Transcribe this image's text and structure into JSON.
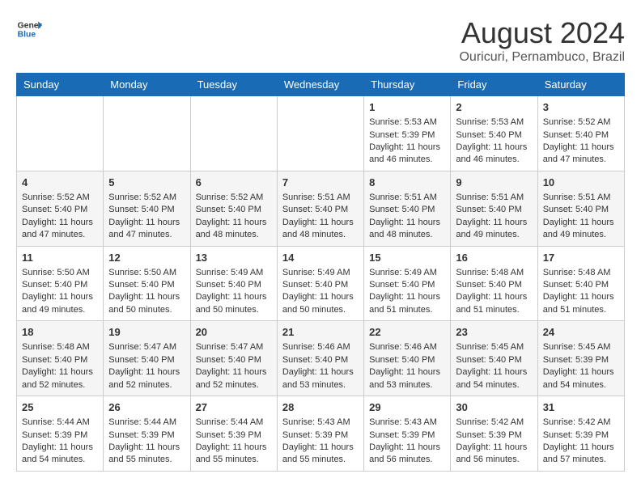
{
  "header": {
    "logo_line1": "General",
    "logo_line2": "Blue",
    "month_title": "August 2024",
    "location": "Ouricuri, Pernambuco, Brazil"
  },
  "days_of_week": [
    "Sunday",
    "Monday",
    "Tuesday",
    "Wednesday",
    "Thursday",
    "Friday",
    "Saturday"
  ],
  "weeks": [
    [
      {
        "day": "",
        "content": ""
      },
      {
        "day": "",
        "content": ""
      },
      {
        "day": "",
        "content": ""
      },
      {
        "day": "",
        "content": ""
      },
      {
        "day": "1",
        "content": "Sunrise: 5:53 AM\nSunset: 5:39 PM\nDaylight: 11 hours\nand 46 minutes."
      },
      {
        "day": "2",
        "content": "Sunrise: 5:53 AM\nSunset: 5:40 PM\nDaylight: 11 hours\nand 46 minutes."
      },
      {
        "day": "3",
        "content": "Sunrise: 5:52 AM\nSunset: 5:40 PM\nDaylight: 11 hours\nand 47 minutes."
      }
    ],
    [
      {
        "day": "4",
        "content": "Sunrise: 5:52 AM\nSunset: 5:40 PM\nDaylight: 11 hours\nand 47 minutes."
      },
      {
        "day": "5",
        "content": "Sunrise: 5:52 AM\nSunset: 5:40 PM\nDaylight: 11 hours\nand 47 minutes."
      },
      {
        "day": "6",
        "content": "Sunrise: 5:52 AM\nSunset: 5:40 PM\nDaylight: 11 hours\nand 48 minutes."
      },
      {
        "day": "7",
        "content": "Sunrise: 5:51 AM\nSunset: 5:40 PM\nDaylight: 11 hours\nand 48 minutes."
      },
      {
        "day": "8",
        "content": "Sunrise: 5:51 AM\nSunset: 5:40 PM\nDaylight: 11 hours\nand 48 minutes."
      },
      {
        "day": "9",
        "content": "Sunrise: 5:51 AM\nSunset: 5:40 PM\nDaylight: 11 hours\nand 49 minutes."
      },
      {
        "day": "10",
        "content": "Sunrise: 5:51 AM\nSunset: 5:40 PM\nDaylight: 11 hours\nand 49 minutes."
      }
    ],
    [
      {
        "day": "11",
        "content": "Sunrise: 5:50 AM\nSunset: 5:40 PM\nDaylight: 11 hours\nand 49 minutes."
      },
      {
        "day": "12",
        "content": "Sunrise: 5:50 AM\nSunset: 5:40 PM\nDaylight: 11 hours\nand 50 minutes."
      },
      {
        "day": "13",
        "content": "Sunrise: 5:49 AM\nSunset: 5:40 PM\nDaylight: 11 hours\nand 50 minutes."
      },
      {
        "day": "14",
        "content": "Sunrise: 5:49 AM\nSunset: 5:40 PM\nDaylight: 11 hours\nand 50 minutes."
      },
      {
        "day": "15",
        "content": "Sunrise: 5:49 AM\nSunset: 5:40 PM\nDaylight: 11 hours\nand 51 minutes."
      },
      {
        "day": "16",
        "content": "Sunrise: 5:48 AM\nSunset: 5:40 PM\nDaylight: 11 hours\nand 51 minutes."
      },
      {
        "day": "17",
        "content": "Sunrise: 5:48 AM\nSunset: 5:40 PM\nDaylight: 11 hours\nand 51 minutes."
      }
    ],
    [
      {
        "day": "18",
        "content": "Sunrise: 5:48 AM\nSunset: 5:40 PM\nDaylight: 11 hours\nand 52 minutes."
      },
      {
        "day": "19",
        "content": "Sunrise: 5:47 AM\nSunset: 5:40 PM\nDaylight: 11 hours\nand 52 minutes."
      },
      {
        "day": "20",
        "content": "Sunrise: 5:47 AM\nSunset: 5:40 PM\nDaylight: 11 hours\nand 52 minutes."
      },
      {
        "day": "21",
        "content": "Sunrise: 5:46 AM\nSunset: 5:40 PM\nDaylight: 11 hours\nand 53 minutes."
      },
      {
        "day": "22",
        "content": "Sunrise: 5:46 AM\nSunset: 5:40 PM\nDaylight: 11 hours\nand 53 minutes."
      },
      {
        "day": "23",
        "content": "Sunrise: 5:45 AM\nSunset: 5:40 PM\nDaylight: 11 hours\nand 54 minutes."
      },
      {
        "day": "24",
        "content": "Sunrise: 5:45 AM\nSunset: 5:39 PM\nDaylight: 11 hours\nand 54 minutes."
      }
    ],
    [
      {
        "day": "25",
        "content": "Sunrise: 5:44 AM\nSunset: 5:39 PM\nDaylight: 11 hours\nand 54 minutes."
      },
      {
        "day": "26",
        "content": "Sunrise: 5:44 AM\nSunset: 5:39 PM\nDaylight: 11 hours\nand 55 minutes."
      },
      {
        "day": "27",
        "content": "Sunrise: 5:44 AM\nSunset: 5:39 PM\nDaylight: 11 hours\nand 55 minutes."
      },
      {
        "day": "28",
        "content": "Sunrise: 5:43 AM\nSunset: 5:39 PM\nDaylight: 11 hours\nand 55 minutes."
      },
      {
        "day": "29",
        "content": "Sunrise: 5:43 AM\nSunset: 5:39 PM\nDaylight: 11 hours\nand 56 minutes."
      },
      {
        "day": "30",
        "content": "Sunrise: 5:42 AM\nSunset: 5:39 PM\nDaylight: 11 hours\nand 56 minutes."
      },
      {
        "day": "31",
        "content": "Sunrise: 5:42 AM\nSunset: 5:39 PM\nDaylight: 11 hours\nand 57 minutes."
      }
    ]
  ]
}
